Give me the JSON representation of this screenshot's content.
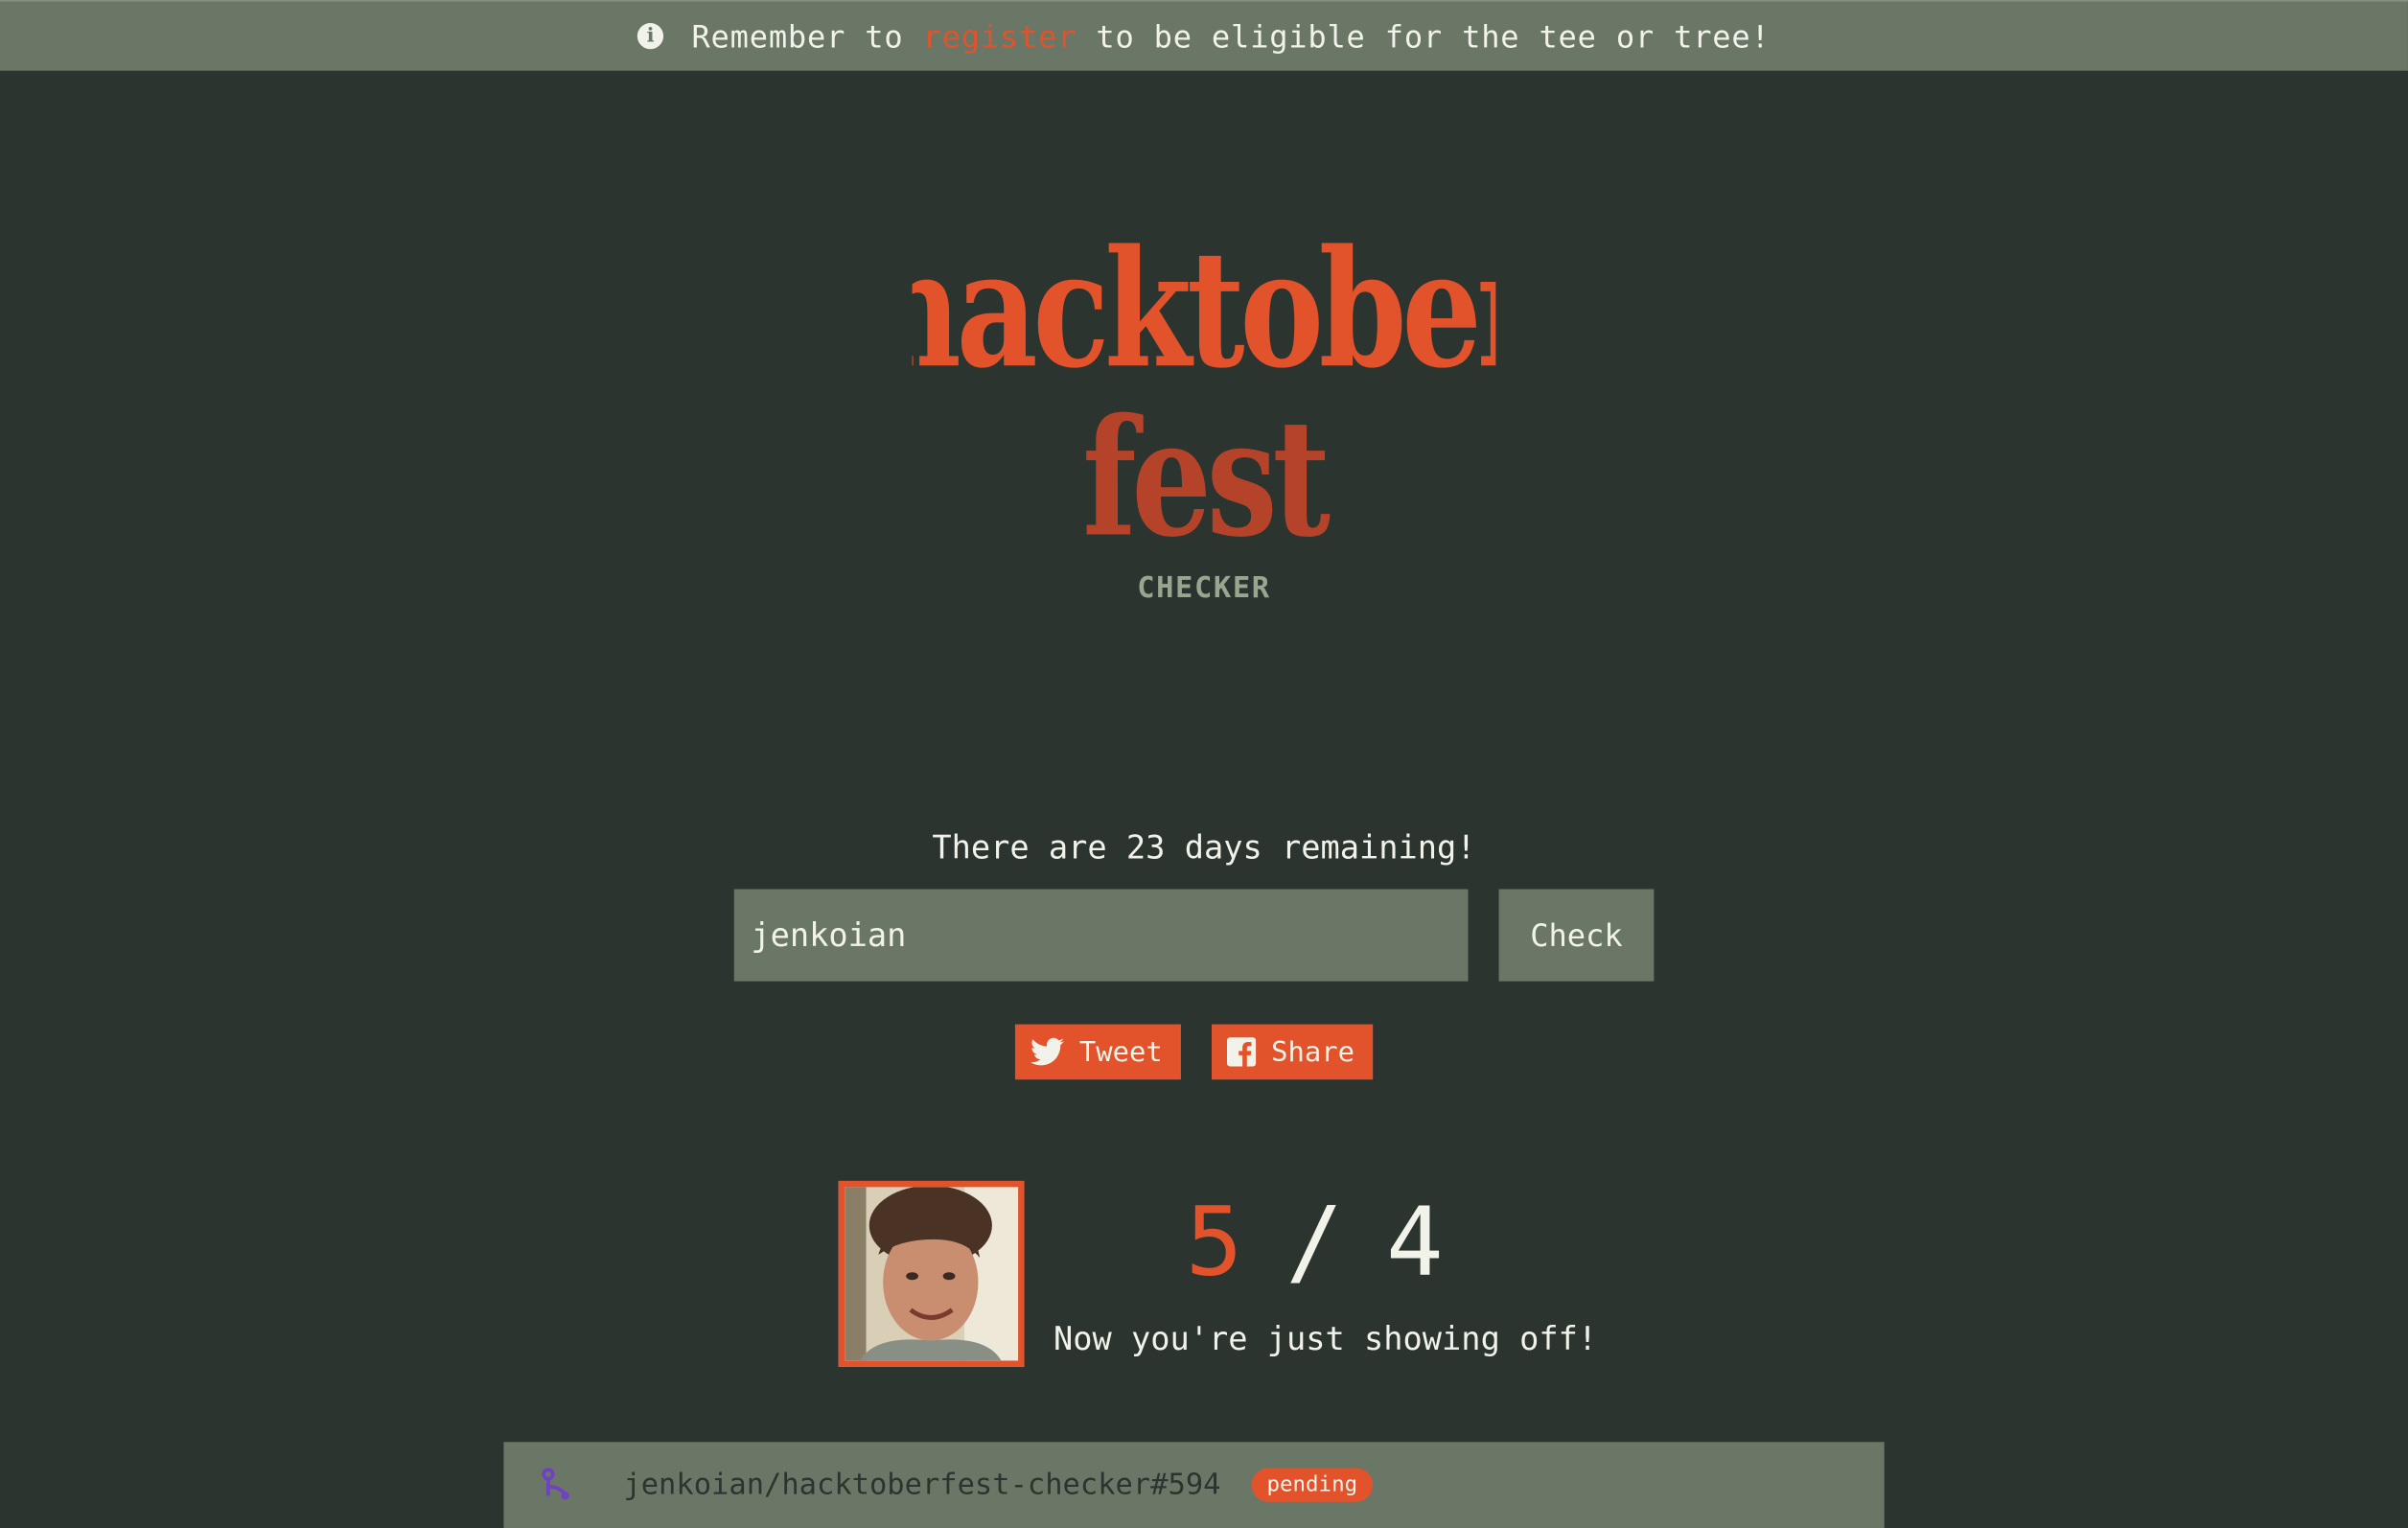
{
  "banner": {
    "before": "Remember to",
    "link": "register",
    "after": "to be eligible for the tee or tree!"
  },
  "logo": {
    "line1": "hacktober",
    "line2": "fest",
    "subtitle": "CHECKER"
  },
  "remaining_text": "There are 23 days remaining!",
  "search": {
    "value": "jenkoian",
    "button_label": "Check"
  },
  "share": {
    "tweet_label": "Tweet",
    "share_label": "Share"
  },
  "result": {
    "count": "5",
    "separator": "/",
    "goal": "4",
    "message": "Now you're just showing off!"
  },
  "pull_requests": [
    {
      "title": "jenkoian/hacktoberfest-checker#594",
      "status": "pending"
    }
  ],
  "colors": {
    "background": "#2c3430",
    "accent": "#e2522b",
    "panel": "#6b7766",
    "text": "#f1f3ea",
    "pr_icon": "#6f42c1"
  }
}
